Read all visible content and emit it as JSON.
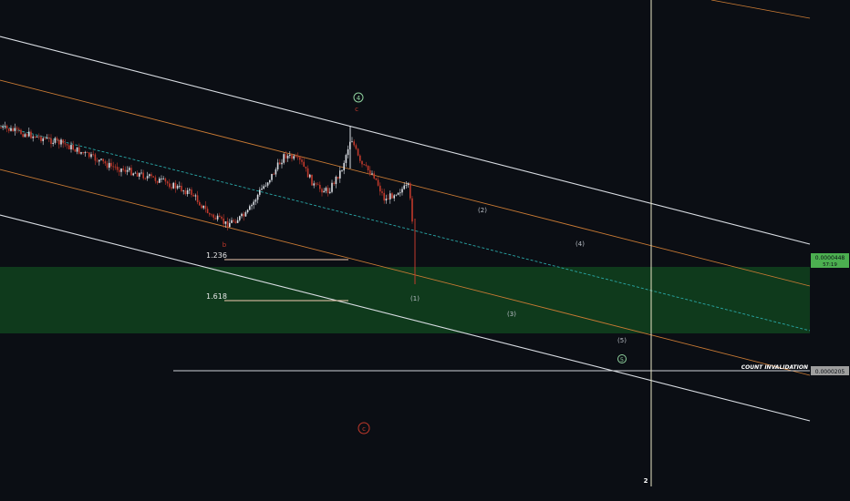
{
  "chart_data": {
    "type": "candlestick",
    "y_scale": "log",
    "grid": false,
    "colors": {
      "background": "#0b0e14",
      "channel_outer": "#d9dde3",
      "channel_inner": "#c97a34",
      "channel_mid": "#2aa7a7",
      "zone_fill": "#0f3a1c",
      "fib_line": "#f0c9b0",
      "candle_up": "#d9dde3",
      "candle_down": "#c0392b",
      "label_badge": "#4caf50",
      "invalidation_badge": "#9e9e9e",
      "crosshair": "#e8e6c6",
      "wave_label": "#b9bec6",
      "wave_label_red": "#c0392b",
      "wave_label_green": "#8fd19e"
    },
    "price_labels": [
      {
        "text": "0.0000448",
        "subtext": "57:19"
      },
      {
        "text": "0.0000205"
      }
    ],
    "fib_levels": [
      "1.236",
      "1.618"
    ],
    "annotations": {
      "count_invalidation": "COUNT INVALIDATION",
      "wave_4_circled": "4",
      "wave_5_circled": "5",
      "wave_c_circled": "c",
      "wave_c_top": "c",
      "wave_b": "b",
      "wave_1": "(1)",
      "wave_2": "(2)",
      "wave_3": "(3)",
      "wave_4": "(4)",
      "wave_5": "(5)",
      "marker_2": "2"
    }
  }
}
